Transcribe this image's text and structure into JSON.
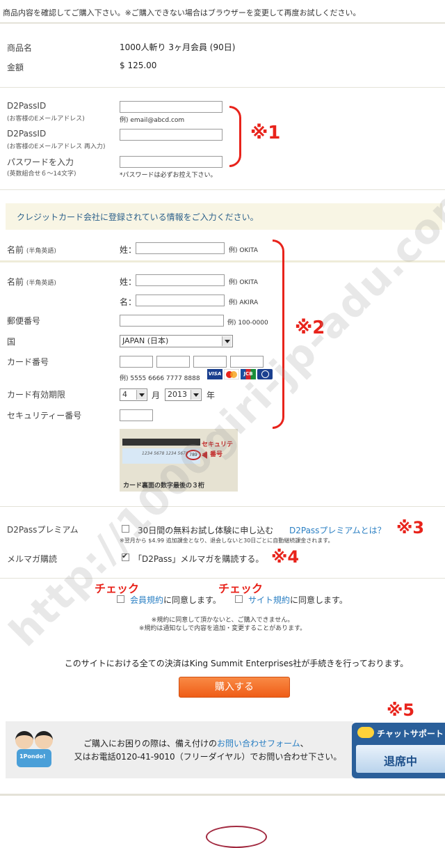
{
  "notice": "商品内容を確認してご購入下さい。※ご購入できない場合はブラウザーを変更して再度お試しください。",
  "product": {
    "name_label": "商品名",
    "name_value": "1000人斬り 3ヶ月会員 (90日)",
    "price_label": "金額",
    "price_value": "$ 125.00"
  },
  "account": {
    "id_label": "D2PassID",
    "id_sub": "(お客様のEメールアドレス)",
    "id_hint": "例) email@abcd.com",
    "id2_label": "D2PassID",
    "id2_sub": "(お客様のEメールアドレス 再入力)",
    "pw_label": "パスワードを入力",
    "pw_sub": "(英数組合せ６〜14文字)",
    "pw_hint": "*パスワードは必ずお控え下さい。"
  },
  "card_banner": "クレジットカード会社に登録されている情報をご入力ください。",
  "name_top": {
    "label": "名前",
    "sub": "(半角英語)",
    "sei": "姓：",
    "hint": "例) OKITA"
  },
  "card": {
    "name_label": "名前",
    "name_sub": "(半角英語)",
    "sei": "姓：",
    "sei_hint": "例) OKITA",
    "mei": "名：",
    "mei_hint": "例) AKIRA",
    "zip_label": "郵便番号",
    "zip_hint": "例) 100-0000",
    "country_label": "国",
    "country_value": "JAPAN (日本)",
    "number_label": "カード番号",
    "number_hint": "例) 5555 6666 7777 8888",
    "brands": [
      "VISA",
      "MC",
      "JCB",
      "DC"
    ],
    "expiry_label": "カード有効期限",
    "month_value": "4",
    "month_unit": "月",
    "year_value": "2013",
    "year_unit": "年",
    "cvv_label": "セキュリティー番号",
    "cvv_img_digits": "1234 5678 1234 5678",
    "cvv_img_code": "789",
    "cvv_img_label1": "セキュリティ",
    "cvv_img_label2": "番号",
    "cvv_img_caption": "カード裏面の数字最後の３桁"
  },
  "premium": {
    "label": "D2Passプレミアム",
    "text": "30日間の無料お試し体験に申し込む",
    "link": "D2Passプレミアムとは？",
    "note": "※翌月から $4.99 追加課金となり、退会しないと30日ごとに自動継続課金されます。"
  },
  "mailmag": {
    "label": "メルマガ購読",
    "text": "「D2Pass」メルマガを購読する。"
  },
  "terms": {
    "check1": "チェック",
    "check2": "チェック",
    "link1": "会員規約",
    "link2": "サイト規約",
    "agree": "に同意します。",
    "note1": "※規約に同意して頂かないと、ご購入できません。",
    "note2": "※規約は通知なしで内容を追加・変更することがあります。"
  },
  "settlement": "このサイトにおける全ての決済はKing Summit Enterprises社が手続きを行っております。",
  "buy_button": "購入する",
  "help": {
    "line1a": "ご購入にお困りの際は、備え付けの",
    "line1_link": "お問い合わせフォーム",
    "line1b": "、",
    "line2": "又はお電話0120-41-9010（フリーダイヤル）でお問い合わせ下さい。",
    "mascot_text": "1Pondo!"
  },
  "chat": {
    "title": "チャットサポート",
    "status": "退席中"
  },
  "annotations": {
    "a1": "※1",
    "a2": "※2",
    "a3": "※3",
    "a4": "※4",
    "a5": "※5"
  },
  "watermark": "http://1000giri-jp-adu.com",
  "colors": {
    "annotation": "#e8231b",
    "link": "#2a7fc3",
    "buy": "#f0641e",
    "banner": "#f8f5e4"
  }
}
